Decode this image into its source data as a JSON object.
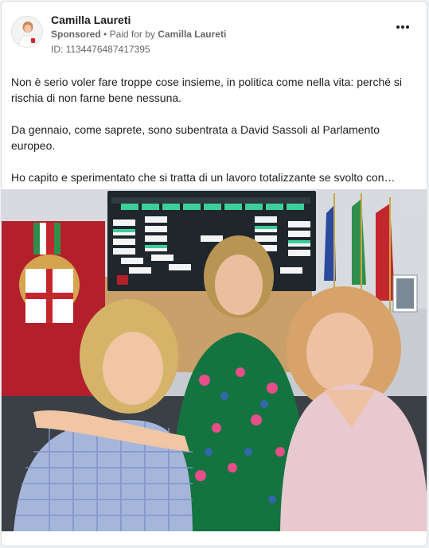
{
  "post": {
    "author": "Camilla Laureti",
    "sponsored_label": "Sponsored",
    "separator": "•",
    "paid_prefix": "Paid for by",
    "paid_by": "Camilla Laureti",
    "id_line": "ID: 1134476487417395",
    "more_icon": "more-horizontal-icon",
    "paragraphs": [
      "Non è serio voler fare troppe cose insieme, in politica come nella vita: perché si rischia di non farne bene nessuna.",
      "Da gennaio, come saprete, sono subentrata a David Sassoli al Parlamento europeo.",
      "Ho capito e sperimentato che si tratta di un lavoro totalizzante se svolto con…"
    ]
  },
  "colors": {
    "text_primary": "#1c1e21",
    "text_secondary": "#65676b",
    "card_bg": "#ffffff",
    "page_bg": "#f0f2f5",
    "banner_red": "#b3202c",
    "screen_green": "#3ccf9a"
  }
}
